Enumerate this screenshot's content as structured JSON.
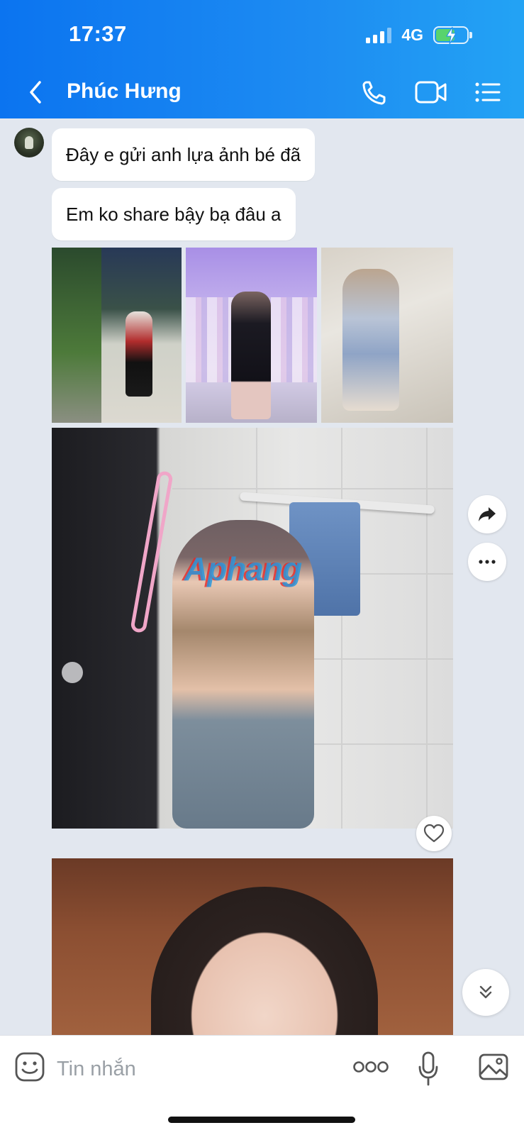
{
  "status_bar": {
    "time": "17:37",
    "network": "4G",
    "battery_icon": "battery-charging-icon",
    "signal_icon": "signal-icon"
  },
  "header": {
    "title": "Phúc Hưng",
    "icons": [
      "back-chevron-icon",
      "phone-icon",
      "video-camera-icon",
      "menu-list-icon"
    ],
    "gradient": [
      "#0b74f0",
      "#23a3f4"
    ]
  },
  "messages": [
    {
      "type": "text",
      "text": "Đây e gửi anh lựa ảnh bé đã"
    },
    {
      "type": "text",
      "text": "Em ko share bậy bạ đâu a"
    },
    {
      "type": "photo-group",
      "count": 3
    },
    {
      "type": "photo",
      "watermark": "Aphang"
    },
    {
      "type": "photo"
    }
  ],
  "side_actions": [
    "share-forward-icon",
    "more-dots-icon",
    "heart-icon",
    "scroll-down-icon"
  ],
  "composer": {
    "placeholder": "Tin nhắn",
    "icons": [
      "sticker-icon",
      "more-options-icon",
      "microphone-icon",
      "gallery-icon"
    ]
  },
  "colors": {
    "background": "#e2e7ef",
    "bubble": "#ffffff",
    "accent": "#0b74f0"
  }
}
